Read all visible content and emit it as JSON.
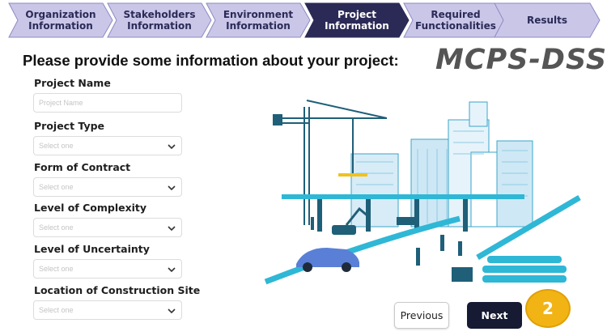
{
  "stepper": {
    "steps": [
      {
        "label": "Organization\nInformation",
        "state": "done"
      },
      {
        "label": "Stakeholders\nInformation",
        "state": "done"
      },
      {
        "label": "Environment\nInformation",
        "state": "done"
      },
      {
        "label": "Project\nInformation",
        "state": "active"
      },
      {
        "label": "Required\nFunctionalities",
        "state": "todo"
      },
      {
        "label": "Results",
        "state": "todo"
      }
    ],
    "colors": {
      "inactive": "#c9c6e8",
      "active": "#2b2a57",
      "border": "#8d8ac2"
    }
  },
  "heading": "Please provide some information about your project:",
  "logo": "MCPS-DSS",
  "form": {
    "project_name": {
      "label": "Project Name",
      "placeholder": "Project Name"
    },
    "project_type": {
      "label": "Project Type",
      "value": "Select one"
    },
    "form_of_contract": {
      "label": "Form of Contract",
      "value": "Select one"
    },
    "level_of_complexity": {
      "label": "Level of Complexity",
      "value": "Select one"
    },
    "level_of_uncertainty": {
      "label": "Level of Uncertainty",
      "value": "Select one"
    },
    "location": {
      "label": "Location of Construction Site",
      "value": "Select one"
    }
  },
  "buttons": {
    "previous": "Previous",
    "next": "Next"
  },
  "badge": "2",
  "icons": {
    "dropdown": "chevron-down-icon",
    "illustration": "construction-site-illustration"
  },
  "accent_colors": {
    "next_button": "#161a33",
    "badge": "#f2b315",
    "illustration": "#2fb7d6"
  }
}
